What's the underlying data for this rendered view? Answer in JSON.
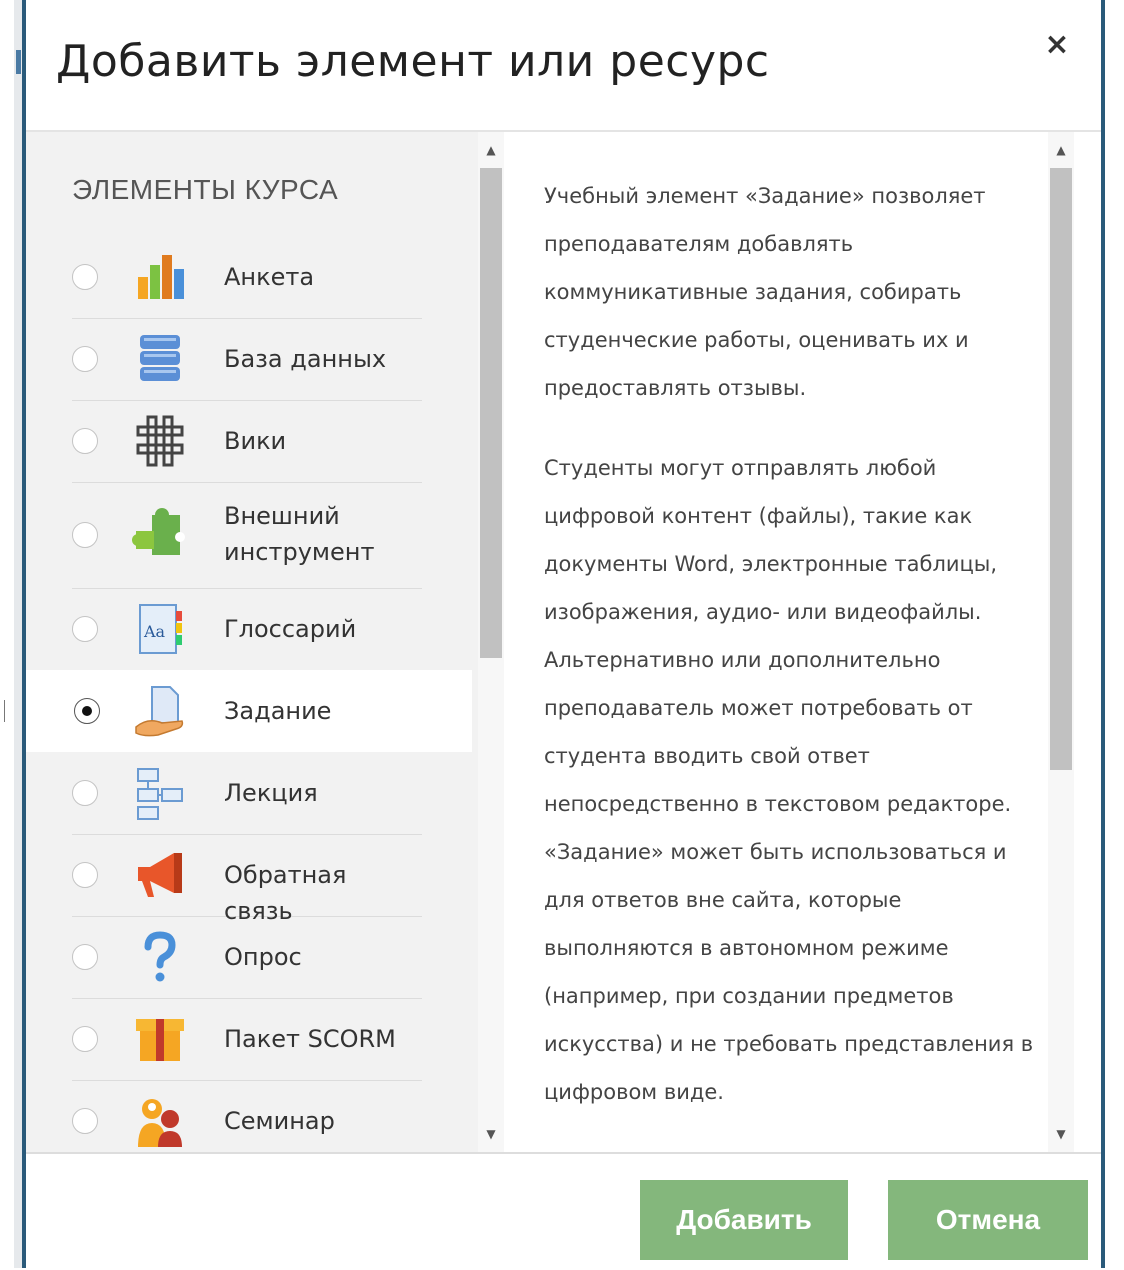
{
  "dialog": {
    "title": "Добавить элемент или ресурс",
    "close_glyph": "×"
  },
  "left": {
    "section_title": "ЭЛЕМЕНТЫ КУРСА",
    "items": [
      {
        "label": "Анкета",
        "icon": "bar-chart-icon",
        "selected": false
      },
      {
        "label": "База данных",
        "icon": "database-icon",
        "selected": false
      },
      {
        "label": "Вики",
        "icon": "wiki-icon",
        "selected": false
      },
      {
        "label": "Внешний инструмент",
        "icon": "puzzle-icon",
        "selected": false
      },
      {
        "label": "Глоссарий",
        "icon": "glossary-icon",
        "selected": false
      },
      {
        "label": "Задание",
        "icon": "assignment-icon",
        "selected": true
      },
      {
        "label": "Лекция",
        "icon": "lesson-icon",
        "selected": false
      },
      {
        "label": "Обратная связь",
        "icon": "megaphone-icon",
        "selected": false
      },
      {
        "label": "Опрос",
        "icon": "question-icon",
        "selected": false
      },
      {
        "label": "Пакет SCORM",
        "icon": "package-icon",
        "selected": false
      },
      {
        "label": "Семинар",
        "icon": "workshop-icon",
        "selected": false
      }
    ]
  },
  "right": {
    "paragraphs": [
      "Учебный элемент «Задание» позволяет преподавателям добавлять коммуникативные задания, собирать студенческие работы, оценивать их и предоставлять отзывы.",
      "Студенты могут отправлять любой цифровой контент (файлы), такие как документы Word, электронные таблицы, изображения, аудио- или видеофайлы. Альтернативно или дополнительно преподаватель может потребовать от студента вводить свой ответ непосредственно в текстовом редакторе. «Задание» может быть использоваться и для ответов вне сайта, которые выполняются в автономном режиме (например, при создании предметов искусства) и не требовать представления в цифровом виде."
    ]
  },
  "footer": {
    "add_label": "Добавить",
    "cancel_label": "Отмена"
  },
  "colors": {
    "button": "#84b77c",
    "frame": "#2a5a7a",
    "left_pane": "#f2f2f2"
  }
}
